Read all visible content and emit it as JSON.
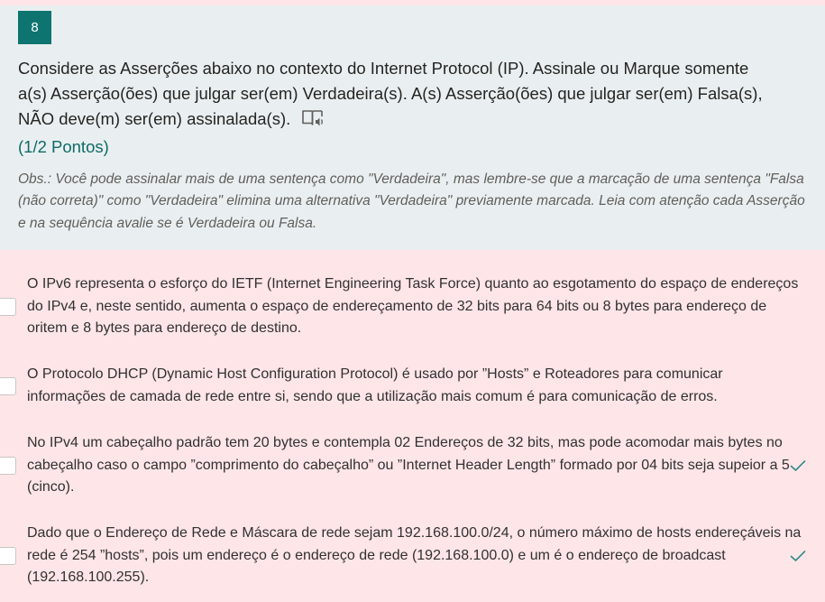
{
  "question": {
    "number": "8",
    "text": "Considere as Asserções abaixo no contexto do Internet Protocol (IP). Assinale ou Marque somente a(s) Asserção(ões) que julgar ser(em) Verdadeira(s). A(s) Asserção(ões) que julgar ser(em) Falsa(s), NÃO deve(m) ser(em) assinalada(s).",
    "points": "(1/2 Pontos)",
    "obs": "Obs.: Você pode assinalar mais de uma sentença como \"Verdadeira\", mas lembre-se que a marcação de uma sentença \"Falsa (não correta)\" como \"Verdadeira\" elimina uma alternativa \"Verdadeira\" previamente marcada. Leia com atenção cada Asserção e na sequência avalie se é Verdadeira ou Falsa.",
    "reader_icon": "immersive-reader-icon"
  },
  "options": [
    {
      "text": "O IPv6 representa o esforço do IETF (Internet Engineering Task Force) quanto ao esgotamento do espaço de endereços do IPv4 e, neste sentido, aumenta o espaço de endereçamento de 32 bits para 64 bits ou 8 bytes para endereço de oritem e 8 bytes para endereço de destino.",
      "checked": false,
      "correct_mark": false
    },
    {
      "text": "O Protocolo DHCP (Dynamic Host Configuration Protocol) é usado por ”Hosts” e Roteadores para comunicar informações de camada de rede entre si, sendo que a utilização mais comum é para comunicação de erros.",
      "checked": false,
      "correct_mark": false
    },
    {
      "text": "No IPv4 um cabeçalho padrão tem 20 bytes e contempla 02 Endereços de 32 bits, mas pode acomodar mais bytes no cabeçalho caso o campo ”comprimento do cabeçalho” ou ”Internet Header Length” formado por 04 bits seja supeior a 5 (cinco).",
      "checked": false,
      "correct_mark": true
    },
    {
      "text": "Dado que o Endereço de Rede e Máscara de rede sejam 192.168.100.0/24, o número máximo de hosts endereçáveis na rede é 254 ”hosts”, pois um endereço é o endereço de rede (192.168.100.0) e um é o endereço de broadcast (192.168.100.255).",
      "checked": false,
      "correct_mark": true
    }
  ],
  "colors": {
    "accent": "#0e7470",
    "header_bg": "#e9eff0",
    "options_bg": "#fde5e8",
    "check_color": "#2e8b88"
  }
}
